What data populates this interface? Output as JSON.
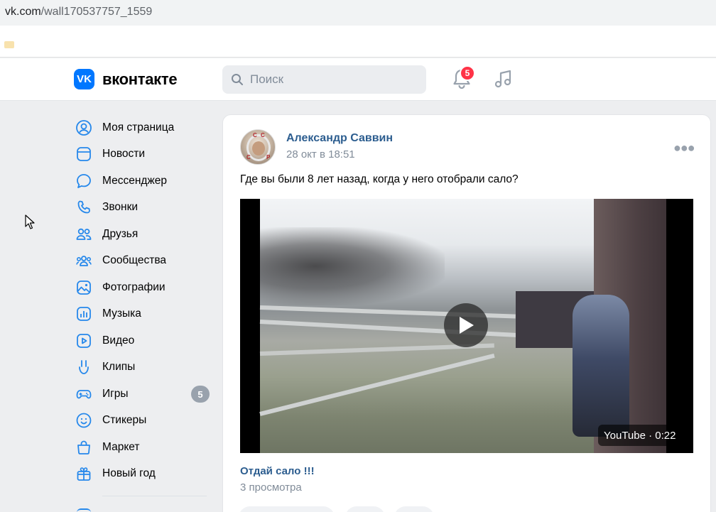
{
  "browser": {
    "url_host": "vk.com",
    "url_path": "/wall170537757_1559"
  },
  "header": {
    "logo_mark": "VK",
    "logo_text": "вконтакте",
    "search_placeholder": "Поиск",
    "notifications_count": "5"
  },
  "sidebar": {
    "items": [
      {
        "label": "Моя страница",
        "icon": "profile-icon"
      },
      {
        "label": "Новости",
        "icon": "news-icon"
      },
      {
        "label": "Мессенджер",
        "icon": "messenger-icon"
      },
      {
        "label": "Звонки",
        "icon": "phone-icon"
      },
      {
        "label": "Друзья",
        "icon": "friends-icon"
      },
      {
        "label": "Сообщества",
        "icon": "communities-icon"
      },
      {
        "label": "Фотографии",
        "icon": "photos-icon"
      },
      {
        "label": "Музыка",
        "icon": "music-icon"
      },
      {
        "label": "Видео",
        "icon": "video-icon"
      },
      {
        "label": "Клипы",
        "icon": "clips-icon"
      },
      {
        "label": "Игры",
        "icon": "games-icon",
        "count": "5"
      },
      {
        "label": "Стикеры",
        "icon": "stickers-icon"
      },
      {
        "label": "Маркет",
        "icon": "market-icon"
      },
      {
        "label": "Новый год",
        "icon": "gift-icon"
      }
    ]
  },
  "post": {
    "author": "Александр Саввин",
    "date": "28 окт в 18:51",
    "text": "Где вы были 8 лет назад, когда у него отобрали сало?",
    "avatar_letters": [
      "С",
      "С",
      "С",
      "Р"
    ],
    "video": {
      "duration_label": "YouTube · 0:22",
      "title": "Отдай сало !!!",
      "views": "3 просмотра"
    }
  },
  "colors": {
    "accent": "#2688eb",
    "brand": "#0077ff",
    "link": "#2c5d8f",
    "muted": "#818c99",
    "badge": "#ff3347"
  }
}
